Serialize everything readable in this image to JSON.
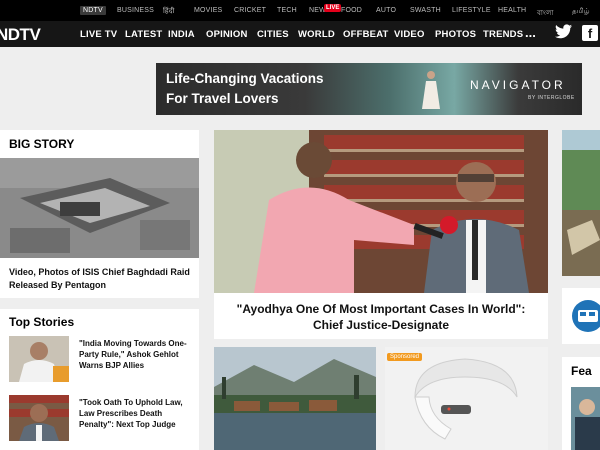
{
  "network_bar": {
    "items": [
      "NDTV",
      "BUSINESS",
      "हिंदी",
      "MOVIES",
      "CRICKET",
      "TECH",
      "NEW",
      "FOOD",
      "AUTO",
      "SWASTH",
      "LIFESTYLE",
      "HEALTH",
      "বাংলা",
      "தமிழ்"
    ],
    "live_badge": "LIVE"
  },
  "header": {
    "logo_text": "NDTV",
    "nav": [
      "LIVE TV",
      "LATEST",
      "INDIA",
      "OPINION",
      "CITIES",
      "WORLD",
      "OFFBEAT",
      "VIDEO",
      "PHOTOS",
      "TRENDS"
    ],
    "more_label": "...",
    "social_icons": [
      "twitter-icon",
      "facebook-icon"
    ]
  },
  "banner_ad": {
    "line1": "Life-Changing Vacations",
    "line2": "For Travel Lovers",
    "brand": "NAVIGATOR",
    "sub": "BY INTERGLOBE"
  },
  "big_story": {
    "section_title": "BIG STORY",
    "headline": "Video, Photos of ISIS Chief Baghdadi Raid Released By Pentagon"
  },
  "feature": {
    "headline": "\"Ayodhya One Of Most Important Cases In World\": Chief Justice-Designate"
  },
  "top_stories": {
    "section_title": "Top Stories",
    "items": [
      "\"India Moving Towards One-Party Rule,\" Ashok Gehlot Warns BJP Allies",
      "\"Took Oath To Uphold Law, Law Prescribes Death Penalty\": Next Top Judge"
    ]
  },
  "sponsored": {
    "badge": "Sponsored"
  },
  "right_column": {
    "partial_title": "Fea"
  },
  "colors": {
    "brand_red": "#e3001b",
    "nav_bg": "#161616",
    "page_bg": "#eeeeee"
  }
}
